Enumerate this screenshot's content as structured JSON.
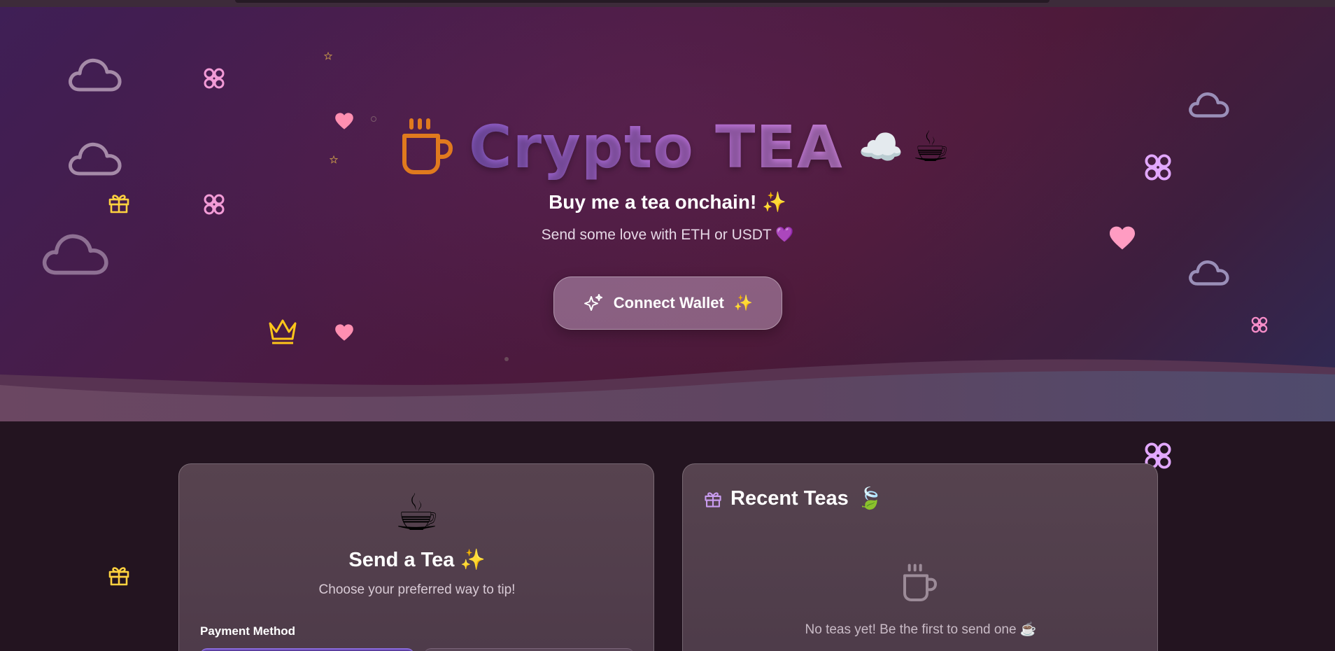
{
  "hero": {
    "title": "Crypto TEA",
    "title_emoji_cloud": "☁️",
    "title_emoji_tea": "☕",
    "subtitle": "Buy me a tea onchain! ✨",
    "tagline": "Send some love with ETH or USDT 💜",
    "connect_button": {
      "label": "Connect Wallet",
      "trailing_emoji": "✨"
    }
  },
  "send_card": {
    "emoji": "☕",
    "title": "Send a Tea ✨",
    "subtitle": "Choose your preferred way to tip!",
    "payment_method_label": "Payment Method"
  },
  "recent_card": {
    "title": "Recent Teas",
    "title_emoji": "🍃",
    "empty_text": "No teas yet! Be the first to send one ☕"
  },
  "icons": {
    "hero_left": "coffee-cup-icon",
    "connect_left": "sparkles-icon",
    "recent_left": "gift-icon",
    "empty_state": "coffee-cup-icon"
  },
  "colors": {
    "title_gradient_start": "#8a5ac4",
    "title_gradient_end": "#c77fd6",
    "cup_orange": "#e07a1e",
    "heart_pink": "#ff8fb1",
    "flower_pink": "#f29bd6",
    "flower_lilac": "#e2a8ff",
    "gift_yellow": "#ffd23f",
    "crown_yellow": "#ffc61a"
  }
}
